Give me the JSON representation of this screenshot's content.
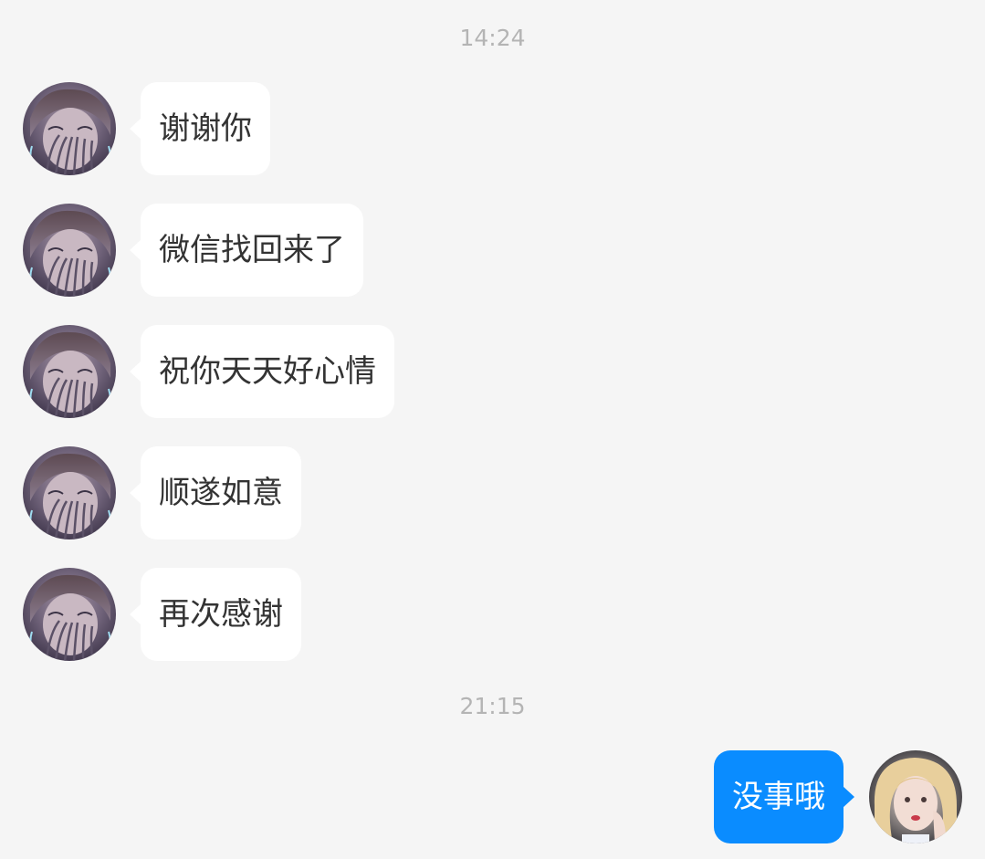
{
  "chat": {
    "timestamps": [
      "14:24",
      "21:15"
    ],
    "incoming": [
      {
        "text": "谢谢你",
        "avatar_icon": "contact-avatar-icon"
      },
      {
        "text": "微信找回来了",
        "avatar_icon": "contact-avatar-icon"
      },
      {
        "text": "祝你天天好心情",
        "avatar_icon": "contact-avatar-icon"
      },
      {
        "text": "顺遂如意",
        "avatar_icon": "contact-avatar-icon"
      },
      {
        "text": "再次感谢",
        "avatar_icon": "contact-avatar-icon"
      }
    ],
    "outgoing": [
      {
        "text": "没事哦",
        "avatar_icon": "self-avatar-icon"
      }
    ]
  },
  "colors": {
    "background": "#f5f5f5",
    "incoming_bubble": "#ffffff",
    "outgoing_bubble": "#0a8cff",
    "timestamp_text": "#b4b4b4",
    "message_text": "#333333"
  }
}
